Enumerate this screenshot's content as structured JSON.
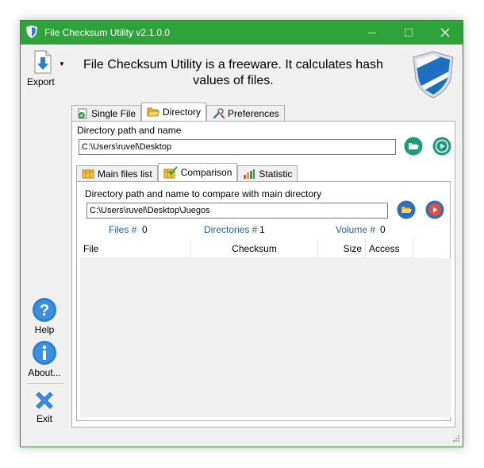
{
  "window": {
    "title": "File Checksum Utility v2.1.0.0",
    "accent": "#2ea33a"
  },
  "toolbar": {
    "export_label": "Export"
  },
  "headline": {
    "line1": "File Checksum Utility is a freeware. It calculates hash",
    "line2": "values of files."
  },
  "sidebar": {
    "help_label": "Help",
    "about_label": "About...",
    "exit_label": "Exit"
  },
  "main_tabs": [
    {
      "label": "Single File",
      "icon": "single-file-icon",
      "active": false
    },
    {
      "label": "Directory",
      "icon": "folder-icon",
      "active": true
    },
    {
      "label": "Preferences",
      "icon": "wrench-icon",
      "active": false
    }
  ],
  "directory": {
    "label": "Directory path and name",
    "value": "C:\\Users\\ruvel\\Desktop"
  },
  "sub_tabs": [
    {
      "label": "Main files list",
      "icon": "list-icon",
      "active": false
    },
    {
      "label": "Comparison",
      "icon": "comparison-icon",
      "active": true
    },
    {
      "label": "Statistic",
      "icon": "bar-chart-icon",
      "active": false
    }
  ],
  "comparison": {
    "label": "Directory path and name to compare with main directory",
    "value": "C:\\Users\\ruvel\\Desktop\\Juegos",
    "files_label": "Files #",
    "files_value": "0",
    "dirs_label": "Directories #",
    "dirs_value": "1",
    "volume_label": "Volume #",
    "volume_value": "0"
  },
  "table": {
    "columns": [
      "File",
      "Checksum",
      "Size",
      "Access"
    ],
    "rows": []
  }
}
